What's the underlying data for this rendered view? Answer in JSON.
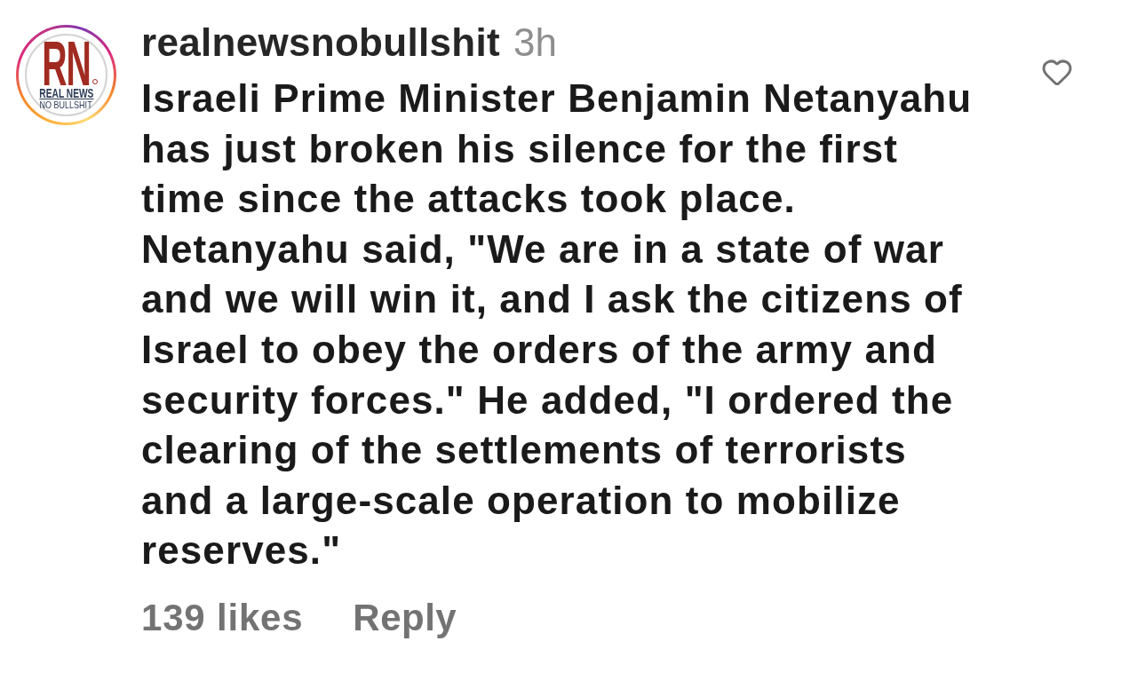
{
  "comment": {
    "avatar": {
      "story_ring": true,
      "logo": {
        "monogram": "RN",
        "line_1": "REAL NEWS",
        "line_2": "NO BULLSHIT"
      }
    },
    "username": "realnewsnobullshit",
    "time": "3h",
    "text_lines": [
      "Israeli Prime Minister Benjamin Netanyahu",
      "has just broken his silence for the first",
      "time since the attacks took place.",
      "Netanyahu said, \"We are in a state of war",
      "and we will win it, and I ask the citizens of",
      "Israel to obey the orders of the army and",
      "security forces.\" He added, \"I ordered the",
      "clearing of the settlements of terrorists",
      "and a large-scale operation to mobilize",
      "reserves.\""
    ],
    "likes": "139 likes",
    "reply": "Reply",
    "liked": false
  }
}
